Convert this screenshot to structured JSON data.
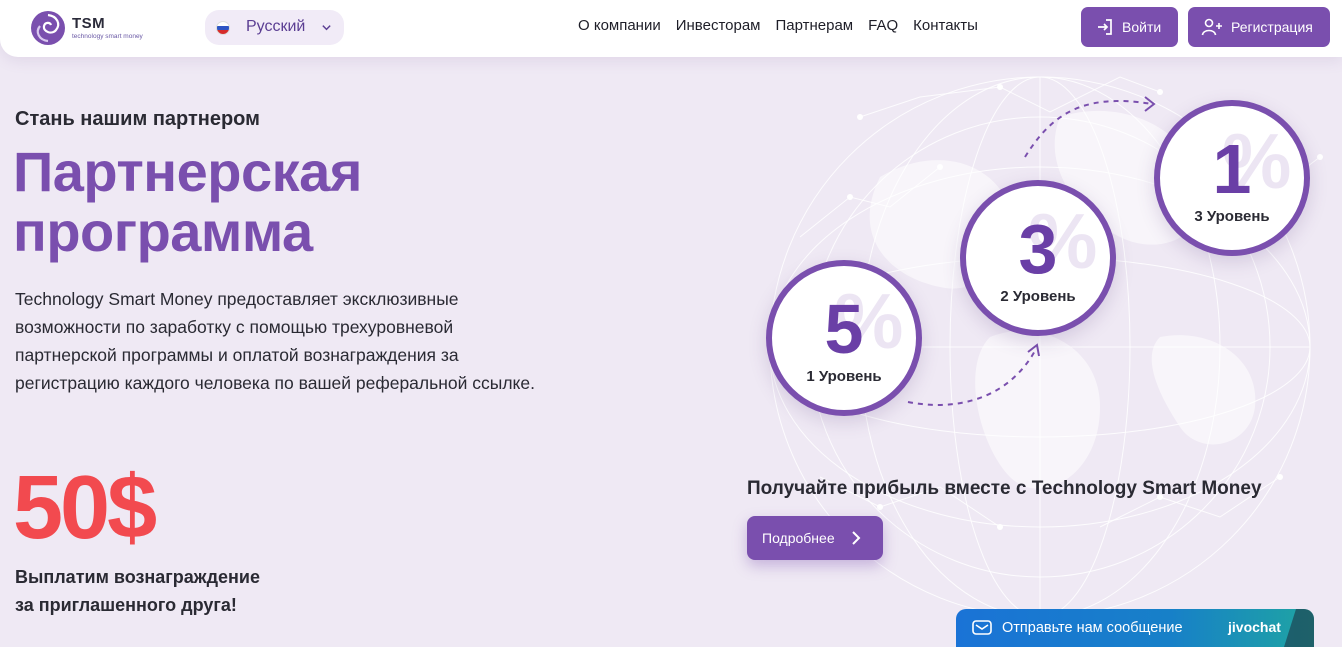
{
  "header": {
    "logo_title": "TSM",
    "logo_sub": "technology smart money",
    "language": "Русский",
    "nav": [
      "О компании",
      "Инвесторам",
      "Партнерам",
      "FAQ",
      "Контакты"
    ],
    "login_label": "Войти",
    "register_label": "Регистрация"
  },
  "hero": {
    "kicker": "Стань нашим партнером",
    "title": "Партнерская программа",
    "description": "Technology Smart Money предоставляет эксклюзивные возможности по заработку с помощью трехуровневой партнерской программы и оплатой вознаграждения за регистрацию каждого человека по вашей реферальной ссылке.",
    "amount": "50$",
    "reward_line1": "Выплатим вознаграждение",
    "reward_line2": "за приглашенного друга!"
  },
  "levels": [
    {
      "percent": "5",
      "label": "1 Уровень"
    },
    {
      "percent": "3",
      "label": "2 Уровень"
    },
    {
      "percent": "1",
      "label": "3 Уровень"
    }
  ],
  "cta": {
    "title": "Получайте прибыль вместе с Technology Smart Money",
    "button": "Подробнее"
  },
  "chat": {
    "text": "Отправьте нам сообщение",
    "brand": "jivochat"
  },
  "colors": {
    "accent": "#7a4fae",
    "amount": "#f24a4f",
    "background": "#efe9f4",
    "chat": "#1a73d6"
  }
}
